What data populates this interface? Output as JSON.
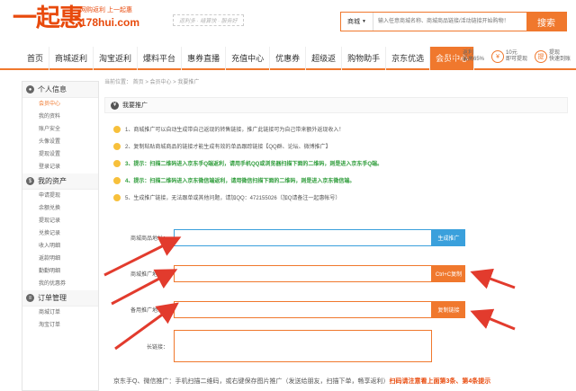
{
  "brand": {
    "logo_text": "一起惠",
    "slogan": "网购返利 上一起惠",
    "domain": "178hui.com",
    "tagline": "返利多 · 结算快 · 服务好"
  },
  "search": {
    "type": "商城",
    "placeholder": "输入任意商城名称、商城商品链接/活动链接开始购物！",
    "button": "搜索"
  },
  "nav": {
    "items": [
      "首页",
      "商城返利",
      "淘宝返利",
      "爆料平台",
      "惠券直播",
      "充值中心",
      "优惠券",
      "超级返",
      "购物助手",
      "京东优选",
      "会员中心"
    ],
    "active_index": 10
  },
  "extras": [
    {
      "icon": "返",
      "line1": "返利",
      "line2": "最高65%"
    },
    {
      "icon": "¥",
      "line1": "10元",
      "line2": "即可提现"
    },
    {
      "icon": "提",
      "line1": "提现",
      "line2": "快速到账"
    }
  ],
  "sidebar": {
    "sections": [
      {
        "title": "个人信息",
        "items": [
          "会员中心",
          "我的资料",
          "账户安全",
          "头像设置",
          "提现设置",
          "登录记录"
        ]
      },
      {
        "title": "我的资产",
        "items": [
          "申请提现",
          "余额兑换",
          "提现记录",
          "兑换记录",
          "收入明细",
          "返款明细",
          "勤勤明细",
          "我的优惠券"
        ]
      },
      {
        "title": "订单管理",
        "items": [
          "商城订单",
          "淘宝订单"
        ]
      }
    ],
    "active_item": "会员中心"
  },
  "breadcrumb": {
    "text": "当前位置： 首页  >  会员中心  >  我要推广"
  },
  "page": {
    "title": "我要推广",
    "notes": [
      {
        "text": "1、商城推广可以自动生成带自己返现的转售链接，推广此链接可为自己带来额外返现收入！",
        "style": "normal"
      },
      {
        "text": "2、复制粘贴商城商品的链接才能生成有效的单品跟踪链接【QQ群、论坛、微博推广】",
        "style": "normal"
      },
      {
        "text": "3、提示：扫描二维码进入京东手Q端返利，请用手机QQ或浏览器扫描下面的二维码，则是进入京东手Q端。",
        "style": "green"
      },
      {
        "text": "4、提示：扫描二维码进入京东微信端返利，请用微信扫描下面的二维码，则是进入京东微信端。",
        "style": "green"
      },
      {
        "text": "5、生成推广链接，无法跟单或其他问题，请加QQ：472155026（加Q请备注一起惠帐号）",
        "style": "normal"
      }
    ],
    "fields": {
      "product_url": {
        "label": "商城商品地址：",
        "value": "",
        "button": "生成推广"
      },
      "promo_url": {
        "label": "商城推广地址：",
        "value": "",
        "button": "Ctrl+C复制"
      },
      "backup_url": {
        "label": "备用推广地址：",
        "value": "",
        "button": "复制链接"
      },
      "long_link": {
        "label": "长链接：",
        "value": ""
      }
    },
    "footer": {
      "normal": "京东手Q、微信推广：手机扫描二维码，或右键保存图片推广（发送给朋友，扫描下单，畅享返利）",
      "red": "扫码请注意看上面第3条、第4条提示"
    }
  },
  "colors": {
    "accent": "#f0782d",
    "brand": "#e84a0c",
    "blue": "#3aa0dc",
    "tip": "#2e9c3a",
    "arrow": "#e23b2d"
  }
}
